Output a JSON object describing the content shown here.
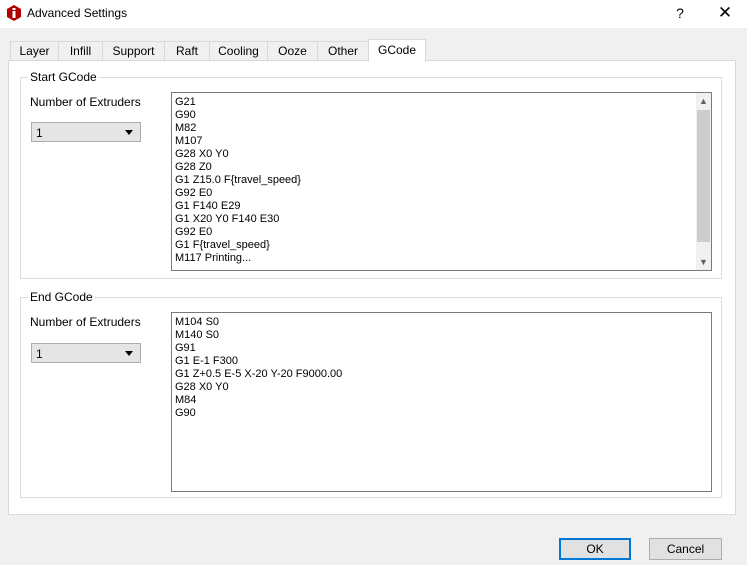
{
  "window": {
    "title": "Advanced Settings",
    "help_label": "?",
    "close_label": "✕"
  },
  "tabs": [
    {
      "label": "Layer"
    },
    {
      "label": "Infill"
    },
    {
      "label": "Support"
    },
    {
      "label": "Raft"
    },
    {
      "label": "Cooling"
    },
    {
      "label": "Ooze"
    },
    {
      "label": "Other"
    },
    {
      "label": "GCode",
      "active": true
    }
  ],
  "start_gcode": {
    "group_title": "Start GCode",
    "extruders_label": "Number of Extruders",
    "extruders_value": "1",
    "lines": [
      "G21",
      "G90",
      "M82",
      "M107",
      "G28 X0 Y0",
      "G28 Z0",
      "G1 Z15.0 F{travel_speed}",
      "G92 E0",
      "G1 F140 E29",
      "G1 X20 Y0 F140 E30",
      "G92 E0",
      "G1 F{travel_speed}",
      "M117 Printing..."
    ]
  },
  "end_gcode": {
    "group_title": "End GCode",
    "extruders_label": "Number of Extruders",
    "extruders_value": "1",
    "lines": [
      "M104 S0",
      "M140 S0",
      "G91",
      "G1 E-1 F300",
      "G1 Z+0.5 E-5 X-20 Y-20 F9000.00",
      "G28 X0 Y0",
      "M84",
      "G90"
    ]
  },
  "buttons": {
    "ok_label": "OK",
    "cancel_label": "Cancel"
  },
  "colors": {
    "app_icon": "#c00000",
    "default_button_border": "#0078d7"
  }
}
